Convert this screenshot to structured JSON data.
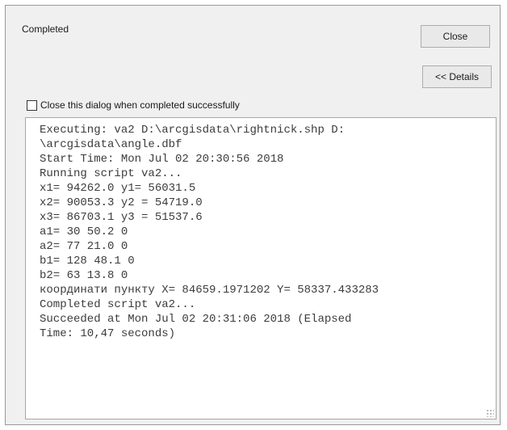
{
  "dialog": {
    "status_text": "Completed",
    "close_label": "Close",
    "details_label": "<< Details",
    "checkbox_label": "Close this dialog when completed successfully",
    "checkbox_checked": false
  },
  "log": {
    "lines": [
      "Executing: va2 D:\\arcgisdata\\rightnick.shp D:",
      "\\arcgisdata\\angle.dbf",
      "Start Time: Mon Jul 02 20:30:56 2018",
      "Running script va2...",
      "x1= 94262.0 y1= 56031.5",
      "x2= 90053.3 y2 = 54719.0",
      "x3= 86703.1 y3 = 51537.6",
      "a1= 30 50.2 0",
      "a2= 77 21.0 0",
      "b1= 128 48.1 0",
      "b2= 63 13.8 0",
      "координати пункту X= 84659.1971202 Y= 58337.433283",
      "Completed script va2...",
      "Succeeded at Mon Jul 02 20:31:06 2018 (Elapsed",
      "Time: 10,47 seconds)"
    ]
  }
}
